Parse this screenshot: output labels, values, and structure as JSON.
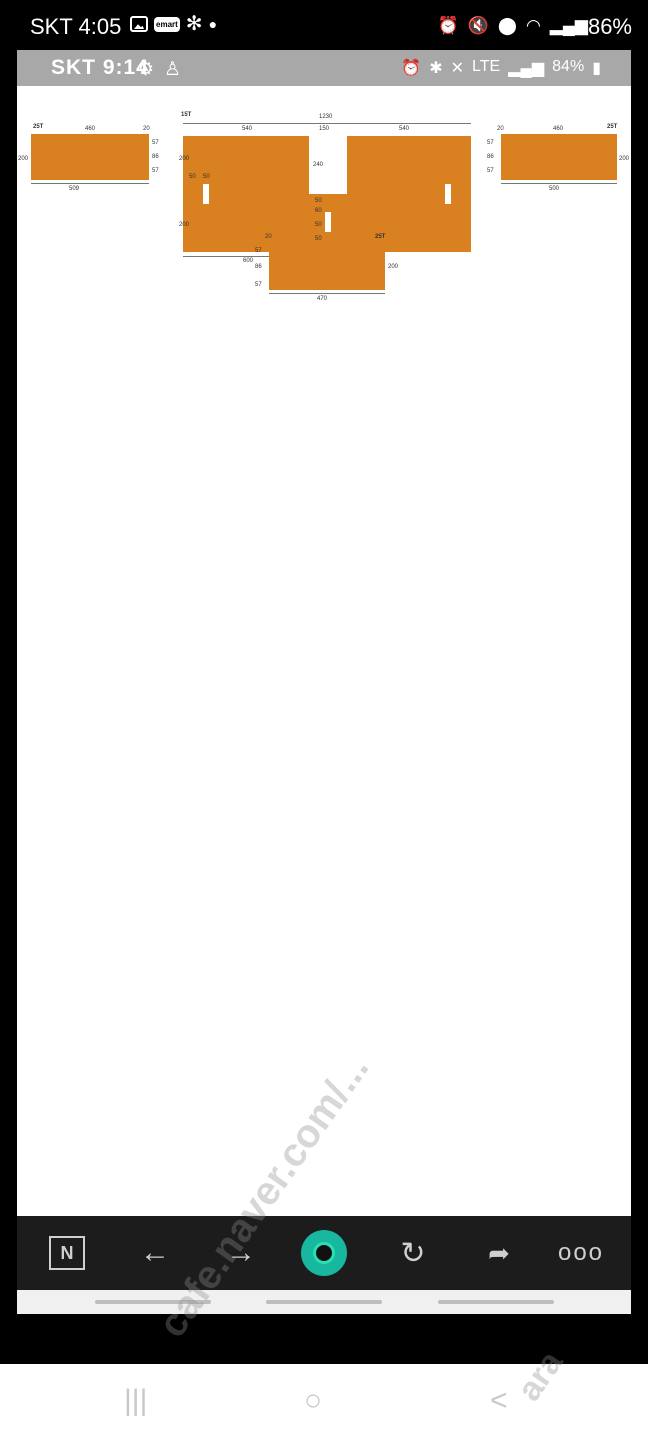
{
  "status": {
    "carrier_time": "SKT 4:05",
    "emart": "emart",
    "battery": "86%",
    "icons_left": [
      "gallery-icon",
      "emart-icon",
      "fan-icon",
      "dot-icon"
    ],
    "icons_right": [
      "alarm-icon",
      "mute-icon",
      "location-icon",
      "wifi-icon",
      "signal-icon"
    ]
  },
  "inner_status": {
    "carrier_time": "SKT 9:14",
    "battery": "84%",
    "lte": "LTE"
  },
  "drawing": {
    "main_label": "15T",
    "top_total": "1230",
    "top_left": "540",
    "top_mid": "150",
    "top_right": "540",
    "left_height_top": "200",
    "left_height_bottom": "200",
    "inner_left": "50",
    "inner_right": "50",
    "notch_depth": "240",
    "bottom_width": "600",
    "center_a": "50",
    "center_b": "60",
    "center_c": "50",
    "center_d": "50",
    "left_panel": {
      "label": "25T",
      "top": "460",
      "corner": "20",
      "height": "200",
      "right_a": "57",
      "right_b": "86",
      "right_c": "57",
      "bottom": "509"
    },
    "right_panel": {
      "label": "25T",
      "top": "460",
      "corner": "20",
      "height": "200",
      "left_a": "57",
      "left_b": "86",
      "left_c": "57",
      "bottom": "500"
    },
    "bottom_panel": {
      "label": "25T",
      "corner": "20",
      "height": "200",
      "left_a": "57",
      "left_b": "86",
      "left_c": "57",
      "bottom": "470"
    }
  },
  "toolbar": {
    "n_label": "N",
    "back": "←",
    "forward": "→",
    "refresh": "↻",
    "share": "➦",
    "more": "ooo"
  },
  "nav": {
    "recent": "|||",
    "home": "○",
    "back": "<"
  },
  "watermark": {
    "main": "cafe.naver.com/...",
    "corner": "ara"
  }
}
